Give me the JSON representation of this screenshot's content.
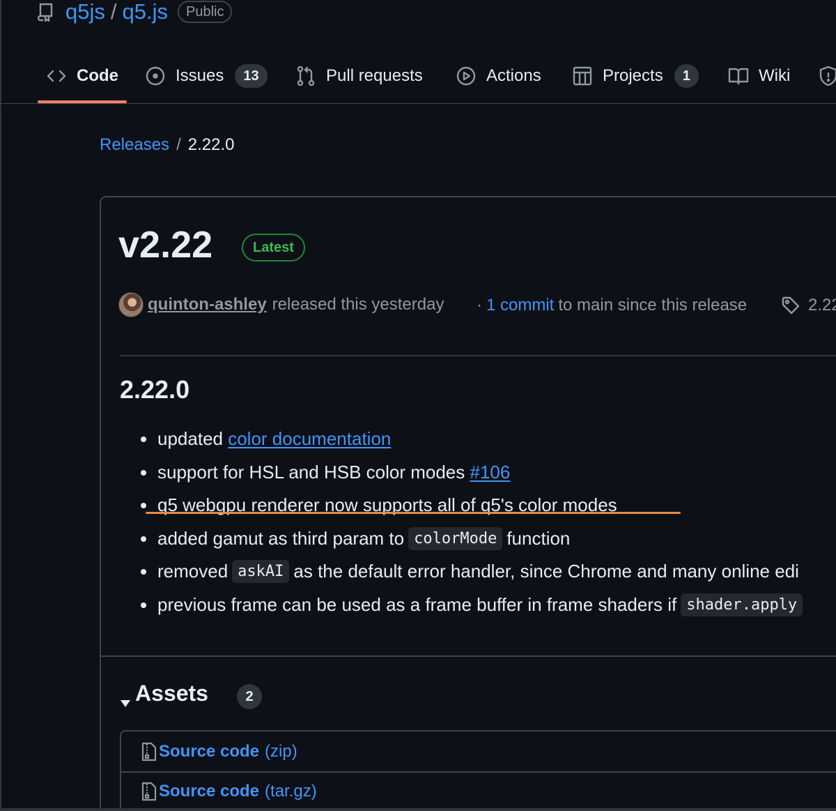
{
  "repo": {
    "owner": "q5js",
    "separator": "/",
    "name": "q5.js",
    "visibility": "Public",
    "icon": "repo-icon"
  },
  "nav": {
    "tabs": [
      {
        "label": "Code",
        "icon": "code-icon",
        "selected": true
      },
      {
        "label": "Issues",
        "icon": "issue-opened-icon",
        "count": "13"
      },
      {
        "label": "Pull requests",
        "icon": "git-pull-request-icon"
      },
      {
        "label": "Actions",
        "icon": "play-icon"
      },
      {
        "label": "Projects",
        "icon": "table-icon",
        "count": "1"
      },
      {
        "label": "Wiki",
        "icon": "book-icon"
      },
      {
        "label": "",
        "icon": "shield-icon"
      }
    ],
    "underline_color": "#f78166"
  },
  "breadcrumb": {
    "parent": "Releases",
    "separator": "/",
    "current": "2.22.0"
  },
  "release": {
    "title": "v2.22",
    "badge": "Latest",
    "author": "quinton-ashley",
    "released_text": "released this yesterday",
    "commits_prefix": "·",
    "commits_link": "1 commit",
    "commits_suffix": "to main since this release",
    "tag": "2.22",
    "notes_title": "2.22.0",
    "notes": {
      "n1_pre": "updated",
      "n1_link": "color documentation",
      "n2_pre": "support for HSL and HSB color modes",
      "n2_link": "#106",
      "n3": "q5 webgpu renderer now supports all of q5's color modes",
      "n4_pre": "added gamut as third param to",
      "n4_code": "colorMode",
      "n4_post": "function",
      "n5_pre": "removed",
      "n5_code": "askAI",
      "n5_post": "as the default error handler, since Chrome and many online edi",
      "n6_pre": "previous frame can be used as a frame buffer in frame shaders if",
      "n6_code": "shader.apply"
    },
    "highlight_color": "#f0883e"
  },
  "assets": {
    "title": "Assets",
    "count": "2",
    "items": [
      {
        "name": "Source code",
        "ext": "(zip)",
        "icon": "file-zip-icon"
      },
      {
        "name": "Source code",
        "ext": "(tar.gz)",
        "icon": "file-zip-icon"
      }
    ]
  },
  "colors": {
    "background": "#0d1117",
    "link": "#4493f8",
    "latest_green": "#3fb950",
    "border": "#3d444d"
  }
}
